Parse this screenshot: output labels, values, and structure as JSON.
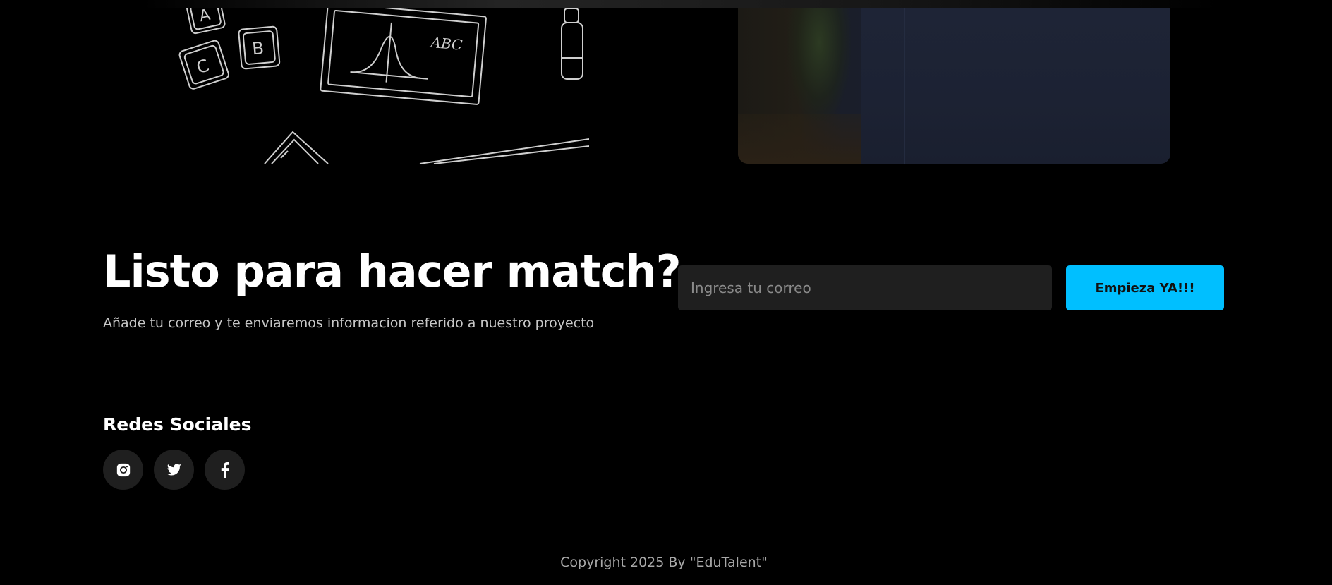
{
  "cta": {
    "title": "Listo para hacer match?",
    "subtitle": "Añade tu correo y te enviaremos informacion referido a nuestro proyecto",
    "email_placeholder": "Ingresa tu correo",
    "button_label": "Empieza YA!!!"
  },
  "social": {
    "heading": "Redes Sociales",
    "links": [
      {
        "icon": "instagram-icon"
      },
      {
        "icon": "twitter-icon"
      },
      {
        "icon": "facebook-icon"
      }
    ]
  },
  "doodle": {
    "text_abc": "ABC",
    "letters": [
      "A",
      "B",
      "C"
    ]
  },
  "footer": {
    "copyright": "Copyright 2025 By \"EduTalent\""
  },
  "colors": {
    "background": "#000000",
    "accent": "#00bfff",
    "input_bg": "#1f1f1f",
    "muted_text": "#c8c8c8"
  }
}
